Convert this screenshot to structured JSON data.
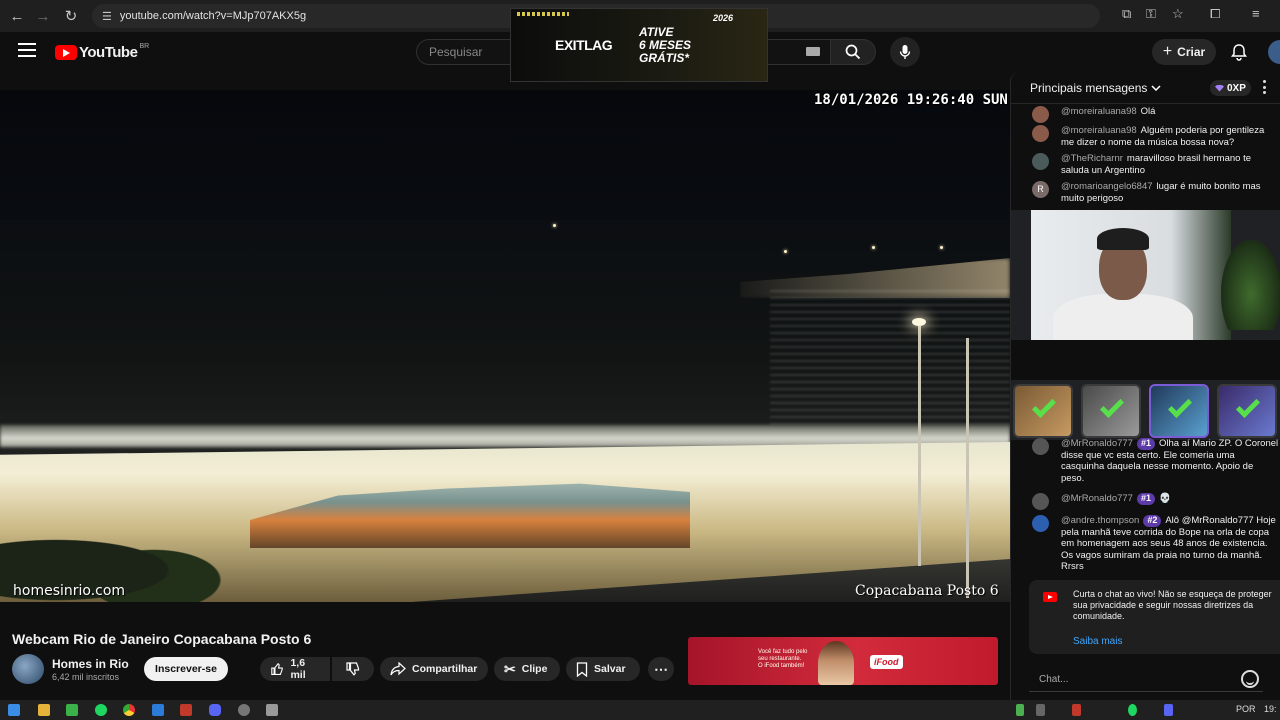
{
  "browser": {
    "url": "youtube.com/watch?v=MJp707AKX5g"
  },
  "header": {
    "logo_text": "YouTube",
    "logo_region": "BR",
    "search_placeholder": "Pesquisar",
    "create_label": "Criar"
  },
  "top_ad": {
    "brand": "EXITLAG",
    "promo_line1": "ATIVE",
    "promo_line2": "6 MESES",
    "promo_line3": "GRÁTIS*",
    "year_tag": "2026"
  },
  "video": {
    "timestamp": "18/01/2026 19:26:40 SUN",
    "watermark": "homesinrio.com",
    "location": "Copacabana Posto 6"
  },
  "details": {
    "title": "Webcam Rio de Janeiro Copacabana Posto 6",
    "channel_name": "Homes in Rio",
    "subscribers": "6,42 mil inscritos",
    "subscribe_label": "Inscrever-se",
    "like_count": "1,6 mil",
    "share_label": "Compartilhar",
    "clip_label": "Clipe",
    "save_label": "Salvar"
  },
  "bottom_ad": {
    "text_line1": "Você faz tudo pelo",
    "text_line2": "seu restaurante.",
    "text_line3": "O iFood também!",
    "brand": "iFood"
  },
  "chat": {
    "title": "Principais mensagens",
    "xp_label": "0XP",
    "messages_top": [
      {
        "author": "@moreiraluana98",
        "text": "Olá"
      },
      {
        "author": "@moreiraluana98",
        "text": "Alguém poderia por gentileza me dizer o nome da música bossa nova?"
      },
      {
        "author": "@TheRicharnr",
        "text": "maravilloso brasil hermano te saluda un Argentino"
      },
      {
        "author": "@romarioangelo6847",
        "text": "lugar é muito bonito mas muito perigoso"
      }
    ],
    "avatar_letter": "R",
    "messages_bottom": [
      {
        "author": "@MrRonaldo777",
        "rank": "#1",
        "text": "Olha aí Mario ZP. O Coronel disse que vc esta certo. Ele comeria uma casquinha daquela nesse momento. Apoio de peso."
      },
      {
        "author": "@MrRonaldo777",
        "rank": "#1",
        "text": "💀"
      },
      {
        "author": "@andre.thompson",
        "rank": "#2",
        "text": "Alô @MrRonaldo777 Hoje pela manhã teve corrida do Bope na orla de copa em homenagem aos seus 48 anos de existencia. Os vagos sumiram da praia no turno da manhã. Rrsrs"
      }
    ],
    "notice_text": "Curta o chat ao vivo! Não se esqueça de proteger sua privacidade e seguir nossas diretrizes da comunidade.",
    "notice_link": "Saiba mais",
    "input_placeholder": "Chat..."
  },
  "taskbar": {
    "lang": "POR",
    "time": "19:"
  },
  "colors": {
    "background": "#0f0f0f",
    "youtube_red": "#ff0000",
    "link_blue": "#3ea6ff",
    "rank_badge": "#5c3aa8",
    "check_green": "#57e04a"
  }
}
